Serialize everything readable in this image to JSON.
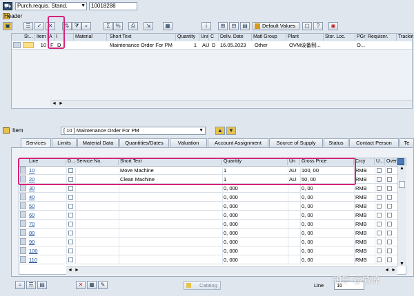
{
  "topbar": {
    "doc_type": "Purch.requis. Stand.",
    "doc_number": "10018288"
  },
  "header_label": "Header",
  "items_grid": {
    "columns": [
      "St...",
      "Item",
      "A",
      "I",
      "Material",
      "Short Text",
      "Quantity",
      "Unit",
      "C",
      "Deliv. Date",
      "Matl Group",
      "Plant",
      "Stor. Loc.",
      "PGr",
      "Requisnr.",
      "Tracking"
    ],
    "row": {
      "item": "10",
      "acct_cat": "F",
      "item_cat": "D",
      "short_text": "Maintenance Order For PM",
      "quantity": "1",
      "unit": "AU",
      "c": "D",
      "deliv_date": "16.05.2023",
      "matl_group": "Other",
      "plant": "OVM设备制...",
      "pgr": "O..."
    },
    "default_values_label": "Default Values"
  },
  "item_section": {
    "label": "Item",
    "selected": "[ 10 ] Maintenance Order For PM"
  },
  "tabs": [
    "Services",
    "Limits",
    "Material Data",
    "Quantities/Dates",
    "Valuation",
    "Account Assignment",
    "Source of Supply",
    "Status",
    "Contact Person",
    "Te"
  ],
  "services": {
    "columns": [
      "Line",
      "D...",
      "Service No.",
      "Short Text",
      "Quantity",
      "Un",
      "Gross Price",
      "Crcy",
      "U...",
      "Over"
    ],
    "rows": [
      {
        "line": "10",
        "short_text": "Move Machine",
        "quantity": "1",
        "unit": "AU",
        "price": "100, 00",
        "crcy": "RMB"
      },
      {
        "line": "20",
        "short_text": "Clean Machine",
        "quantity": "1",
        "unit": "AU",
        "price": "50, 00",
        "crcy": "RMB"
      },
      {
        "line": "30",
        "short_text": "",
        "quantity": "0, 000",
        "unit": "",
        "price": "0, 00",
        "crcy": "RMB"
      },
      {
        "line": "40",
        "short_text": "",
        "quantity": "0, 000",
        "unit": "",
        "price": "0, 00",
        "crcy": "RMB"
      },
      {
        "line": "50",
        "short_text": "",
        "quantity": "0, 000",
        "unit": "",
        "price": "0, 00",
        "crcy": "RMB"
      },
      {
        "line": "60",
        "short_text": "",
        "quantity": "0, 000",
        "unit": "",
        "price": "0, 00",
        "crcy": "RMB"
      },
      {
        "line": "70",
        "short_text": "",
        "quantity": "0, 000",
        "unit": "",
        "price": "0, 00",
        "crcy": "RMB"
      },
      {
        "line": "80",
        "short_text": "",
        "quantity": "0, 000",
        "unit": "",
        "price": "0, 00",
        "crcy": "RMB"
      },
      {
        "line": "90",
        "short_text": "",
        "quantity": "0, 000",
        "unit": "",
        "price": "0, 00",
        "crcy": "RMB"
      },
      {
        "line": "100",
        "short_text": "",
        "quantity": "0, 000",
        "unit": "",
        "price": "0, 00",
        "crcy": "RMB"
      },
      {
        "line": "110",
        "short_text": "",
        "quantity": "0, 000",
        "unit": "",
        "price": "0, 00",
        "crcy": "RMB"
      }
    ]
  },
  "bottom": {
    "catalog_label": "Catalog",
    "line_label": "Line",
    "line_value": "10"
  },
  "watermark": "知乎 @微凉",
  "colors": {
    "highlight": "#d4237a",
    "link": "#1b4fa0"
  }
}
